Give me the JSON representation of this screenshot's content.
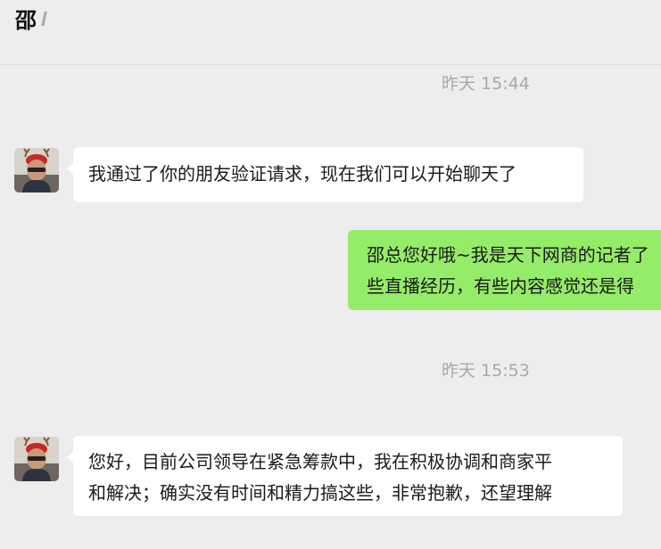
{
  "header": {
    "title": "邵"
  },
  "messages": [
    {
      "timestamp": "昨天 15:44",
      "sender": "contact",
      "lines": [
        "我通过了你的朋友验证请求，现在我们可以开始聊天了"
      ]
    },
    {
      "sender": "me",
      "lines": [
        "邵总您好哦~我是天下网商的记者了",
        "些直播经历，有些内容感觉还是得"
      ]
    },
    {
      "timestamp": "昨天 15:53",
      "sender": "contact",
      "lines": [
        "您好，目前公司领导在紧急筹款中，我在积极协调和商家平",
        "和解决；确实没有时间和精力搞这些，非常抱歉，还望理解"
      ]
    }
  ],
  "colors": {
    "background": "#ededed",
    "incoming_bubble": "#ffffff",
    "outgoing_bubble": "#95ec69",
    "timestamp_text": "#a8a8a8"
  }
}
